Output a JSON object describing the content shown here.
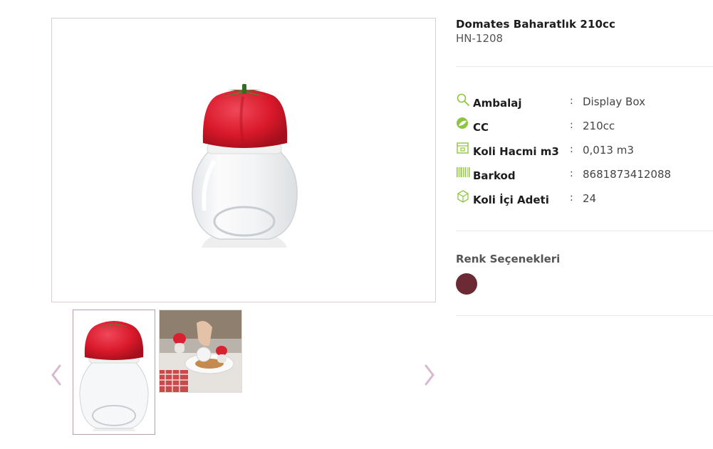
{
  "product": {
    "title": "Domates Baharatlık 210cc",
    "code": "HN-1208"
  },
  "specs": [
    {
      "icon": "search-icon",
      "label": "Ambalaj",
      "colon": ":",
      "value": "Display Box"
    },
    {
      "icon": "leaf-badge-icon",
      "label": "CC",
      "colon": ":",
      "value": "210cc"
    },
    {
      "icon": "box-volume-icon",
      "label": "Koli Hacmi m3",
      "colon": ":",
      "value": "0,013 m3"
    },
    {
      "icon": "barcode-icon",
      "label": "Barkod",
      "colon": ":",
      "value": "8681873412088"
    },
    {
      "icon": "package-icon",
      "label": "Koli İçi Adeti",
      "colon": ":",
      "value": "24"
    }
  ],
  "colors": {
    "title": "Renk Seçenekleri",
    "options": [
      "#6b2a34"
    ]
  },
  "theme": {
    "icon_green": "#8cc63f",
    "thumb_border": "#b8a0b2",
    "arrow": "#d9b8d0"
  }
}
